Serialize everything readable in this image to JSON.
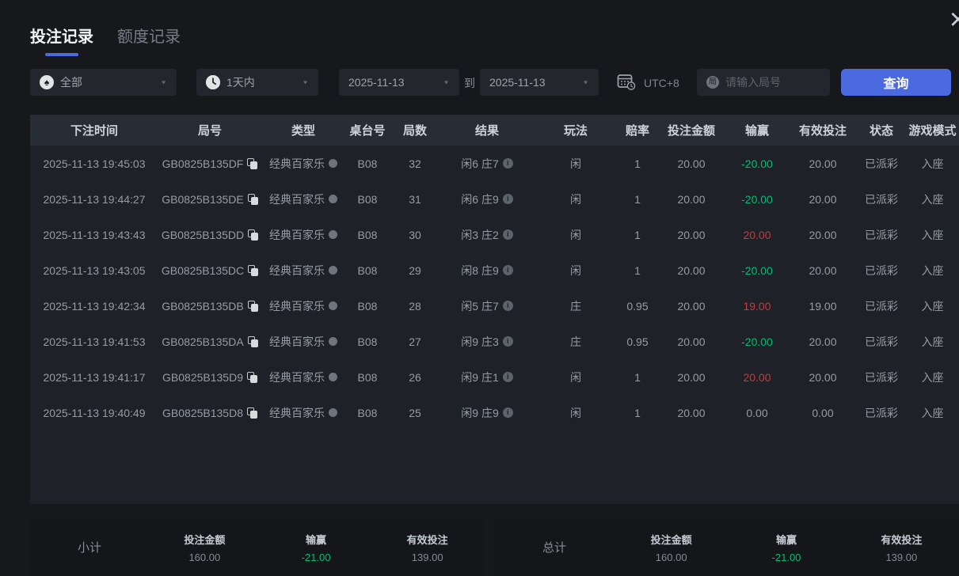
{
  "colors": {
    "accent": "#4c6ae0",
    "green": "#00bf70",
    "red": "#c43c3c"
  },
  "icons": {
    "spade": "♠",
    "caret": "▼",
    "close": "×",
    "info": "i",
    "round_badge": "局"
  },
  "modal": {
    "close_label": "×"
  },
  "tabs": [
    {
      "label": "投注记录",
      "active": true
    },
    {
      "label": "额度记录",
      "active": false
    }
  ],
  "filters": {
    "game_type": {
      "value": "全部"
    },
    "time_range": {
      "value": "1天内"
    },
    "date_from": "2025-11-13",
    "to_label": "到",
    "date_to": "2025-11-13",
    "timezone": "UTC+8",
    "round_input": {
      "placeholder": "请输入局号",
      "value": ""
    },
    "search_button": "查询"
  },
  "table": {
    "headers": [
      "下注时间",
      "局号",
      "类型",
      "桌台号",
      "局数",
      "结果",
      "玩法",
      "赔率",
      "投注金额",
      "输赢",
      "有效投注",
      "状态",
      "游戏模式"
    ],
    "rows": [
      {
        "time": "2025-11-13 19:45:03",
        "round_id": "GB0825B135DF",
        "type": "经典百家乐",
        "table_no": "B08",
        "round_no": "32",
        "result": "闲6 庄7",
        "play": "闲",
        "odds": "1",
        "bet": "20.00",
        "winloss": "-20.00",
        "winloss_color": "green",
        "valid": "20.00",
        "status": "已派彩",
        "mode": "入座"
      },
      {
        "time": "2025-11-13 19:44:27",
        "round_id": "GB0825B135DE",
        "type": "经典百家乐",
        "table_no": "B08",
        "round_no": "31",
        "result": "闲6 庄9",
        "play": "闲",
        "odds": "1",
        "bet": "20.00",
        "winloss": "-20.00",
        "winloss_color": "green",
        "valid": "20.00",
        "status": "已派彩",
        "mode": "入座"
      },
      {
        "time": "2025-11-13 19:43:43",
        "round_id": "GB0825B135DD",
        "type": "经典百家乐",
        "table_no": "B08",
        "round_no": "30",
        "result": "闲3 庄2",
        "play": "闲",
        "odds": "1",
        "bet": "20.00",
        "winloss": "20.00",
        "winloss_color": "red",
        "valid": "20.00",
        "status": "已派彩",
        "mode": "入座"
      },
      {
        "time": "2025-11-13 19:43:05",
        "round_id": "GB0825B135DC",
        "type": "经典百家乐",
        "table_no": "B08",
        "round_no": "29",
        "result": "闲8 庄9",
        "play": "闲",
        "odds": "1",
        "bet": "20.00",
        "winloss": "-20.00",
        "winloss_color": "green",
        "valid": "20.00",
        "status": "已派彩",
        "mode": "入座"
      },
      {
        "time": "2025-11-13 19:42:34",
        "round_id": "GB0825B135DB",
        "type": "经典百家乐",
        "table_no": "B08",
        "round_no": "28",
        "result": "闲5 庄7",
        "play": "庄",
        "odds": "0.95",
        "bet": "20.00",
        "winloss": "19.00",
        "winloss_color": "red",
        "valid": "19.00",
        "status": "已派彩",
        "mode": "入座"
      },
      {
        "time": "2025-11-13 19:41:53",
        "round_id": "GB0825B135DA",
        "type": "经典百家乐",
        "table_no": "B08",
        "round_no": "27",
        "result": "闲9 庄3",
        "play": "庄",
        "odds": "0.95",
        "bet": "20.00",
        "winloss": "-20.00",
        "winloss_color": "green",
        "valid": "20.00",
        "status": "已派彩",
        "mode": "入座"
      },
      {
        "time": "2025-11-13 19:41:17",
        "round_id": "GB0825B135D9",
        "type": "经典百家乐",
        "table_no": "B08",
        "round_no": "26",
        "result": "闲9 庄1",
        "play": "闲",
        "odds": "1",
        "bet": "20.00",
        "winloss": "20.00",
        "winloss_color": "red",
        "valid": "20.00",
        "status": "已派彩",
        "mode": "入座"
      },
      {
        "time": "2025-11-13 19:40:49",
        "round_id": "GB0825B135D8",
        "type": "经典百家乐",
        "table_no": "B08",
        "round_no": "25",
        "result": "闲9 庄9",
        "play": "闲",
        "odds": "1",
        "bet": "20.00",
        "winloss": "0.00",
        "winloss_color": "gray",
        "valid": "0.00",
        "status": "已派彩",
        "mode": "入座"
      }
    ]
  },
  "summary": {
    "subtotal": {
      "label": "小计",
      "bet_label": "投注金额",
      "bet": "160.00",
      "winloss_label": "输赢",
      "winloss": "-21.00",
      "valid_label": "有效投注",
      "valid": "139.00"
    },
    "total": {
      "label": "总计",
      "bet_label": "投注金额",
      "bet": "160.00",
      "winloss_label": "输赢",
      "winloss": "-21.00",
      "valid_label": "有效投注",
      "valid": "139.00"
    }
  }
}
